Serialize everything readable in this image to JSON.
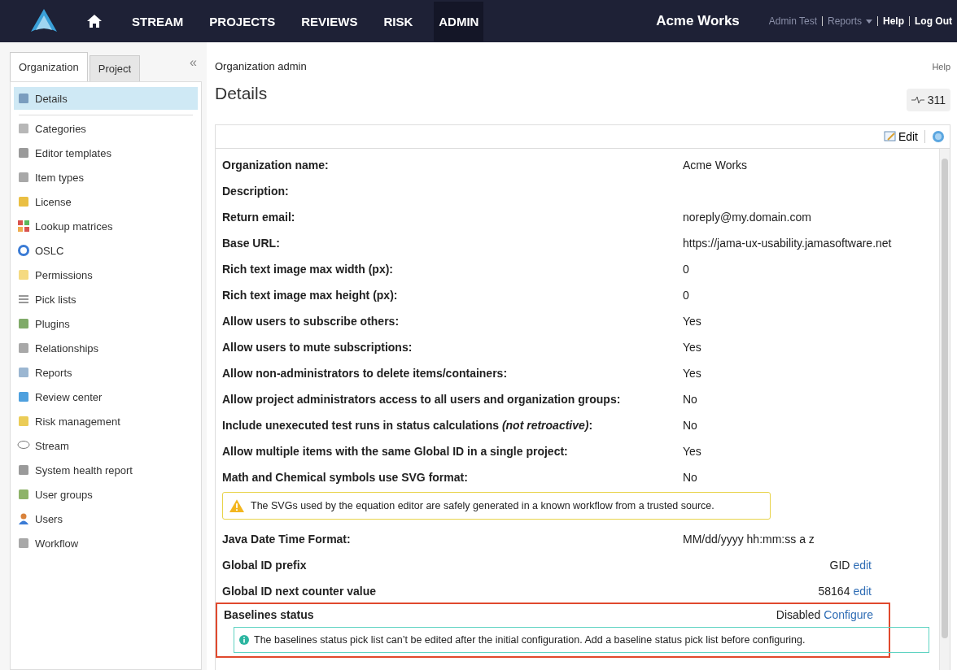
{
  "nav": {
    "items": [
      {
        "label": "STREAM",
        "selected": false
      },
      {
        "label": "PROJECTS",
        "selected": false
      },
      {
        "label": "REVIEWS",
        "selected": false
      },
      {
        "label": "RISK",
        "selected": false
      },
      {
        "label": "ADMIN",
        "selected": true
      }
    ],
    "org": "Acme Works",
    "user": "Admin Test",
    "reports": "Reports",
    "help": "Help",
    "logout": "Log Out"
  },
  "sidebar": {
    "tabs": [
      {
        "label": "Organization",
        "selected": true
      },
      {
        "label": "Project",
        "selected": false
      }
    ],
    "collapse": "«",
    "items": [
      {
        "label": "Details",
        "selected": true
      },
      {
        "label": "Categories",
        "selected": false
      },
      {
        "label": "Editor templates",
        "selected": false
      },
      {
        "label": "Item types",
        "selected": false
      },
      {
        "label": "License",
        "selected": false
      },
      {
        "label": "Lookup matrices",
        "selected": false
      },
      {
        "label": "OSLC",
        "selected": false
      },
      {
        "label": "Permissions",
        "selected": false
      },
      {
        "label": "Pick lists",
        "selected": false
      },
      {
        "label": "Plugins",
        "selected": false
      },
      {
        "label": "Relationships",
        "selected": false
      },
      {
        "label": "Reports",
        "selected": false
      },
      {
        "label": "Review center",
        "selected": false
      },
      {
        "label": "Risk management",
        "selected": false
      },
      {
        "label": "Stream",
        "selected": false
      },
      {
        "label": "System health report",
        "selected": false
      },
      {
        "label": "User groups",
        "selected": false
      },
      {
        "label": "Users",
        "selected": false
      },
      {
        "label": "Workflow",
        "selected": false
      }
    ]
  },
  "main": {
    "breadcrumb": "Organization admin",
    "help": "Help",
    "title": "Details",
    "activity": "311",
    "edit": "Edit",
    "rows": [
      {
        "kind": "field",
        "label": "Organization name:",
        "value": "Acme Works"
      },
      {
        "kind": "field",
        "label": "Description:"
      },
      {
        "kind": "field",
        "label": "Return email:",
        "value": "noreply@my.domain.com"
      },
      {
        "kind": "field",
        "label": "Base URL:",
        "value": "https://jama-ux-usability.jamasoftware.net"
      },
      {
        "kind": "field",
        "label": "Rich text image max width (px):",
        "value": "0"
      },
      {
        "kind": "field",
        "label": "Rich text image max height (px):",
        "value": "0"
      },
      {
        "kind": "field",
        "label": "Allow users to subscribe others:",
        "value": "Yes"
      },
      {
        "kind": "field",
        "label": "Allow users to mute subscriptions:",
        "value": "Yes"
      },
      {
        "kind": "field",
        "label": "Allow non-administrators to delete items/containers:",
        "value": "Yes"
      },
      {
        "kind": "field",
        "label": "Allow project administrators access to all users and organization groups:",
        "value": "No"
      },
      {
        "kind": "field",
        "label": "Include unexecuted test runs in status calculations *(not retroactive)*:",
        "value": "No"
      },
      {
        "kind": "field",
        "label": "Allow multiple items with the same Global ID in a single project:",
        "value": "Yes"
      },
      {
        "kind": "field",
        "label": "Math and Chemical symbols use SVG format:",
        "value": "No"
      },
      {
        "kind": "warning",
        "text": "The SVGs used by the equation editor are safely generated in a known workflow from a trusted source."
      },
      {
        "kind": "field",
        "label": "Java Date Time Format:",
        "value": "MM/dd/yyyy hh:mm:ss a z"
      },
      {
        "kind": "setting",
        "label": "Global ID prefix",
        "value": "GID",
        "link": "edit"
      },
      {
        "kind": "setting",
        "label": "Global ID next counter value",
        "value": "58164",
        "link": "edit"
      }
    ],
    "highlight": {
      "rows": [
        {
          "kind": "setting",
          "label": "Baselines status",
          "value": "Disabled",
          "link": "Configure"
        },
        {
          "kind": "info",
          "text": "The baselines status pick list can’t be edited after the initial configuration. Add a baseline status pick list before configuring."
        }
      ]
    }
  }
}
